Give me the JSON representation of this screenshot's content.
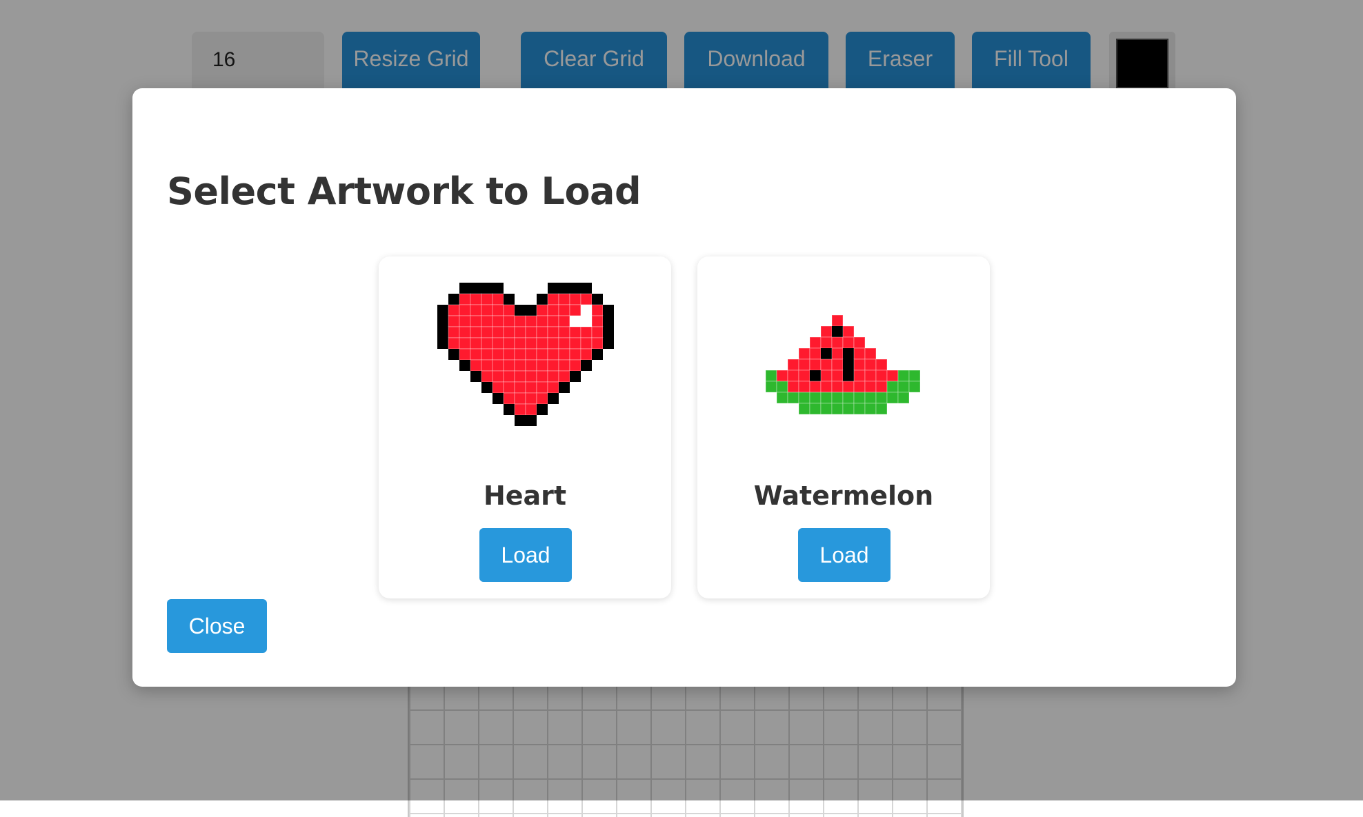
{
  "toolbar": {
    "grid_size_value": "16",
    "resize_label": "Resize Grid",
    "clear_label": "Clear Grid",
    "download_label": "Download",
    "eraser_label": "Eraser",
    "fill_label": "Fill Tool",
    "current_color": "#000000"
  },
  "modal": {
    "title": "Select Artwork to Load",
    "close_label": "Close",
    "artworks": [
      {
        "name": "Heart",
        "load_label": "Load",
        "icon": "heart-pixel-art-icon"
      },
      {
        "name": "Watermelon",
        "load_label": "Load",
        "icon": "watermelon-pixel-art-icon"
      }
    ]
  },
  "colors": {
    "button_blue": "#2898dc",
    "overlay": "rgba(0,0,0,0.4)",
    "text_dark": "#333333"
  }
}
